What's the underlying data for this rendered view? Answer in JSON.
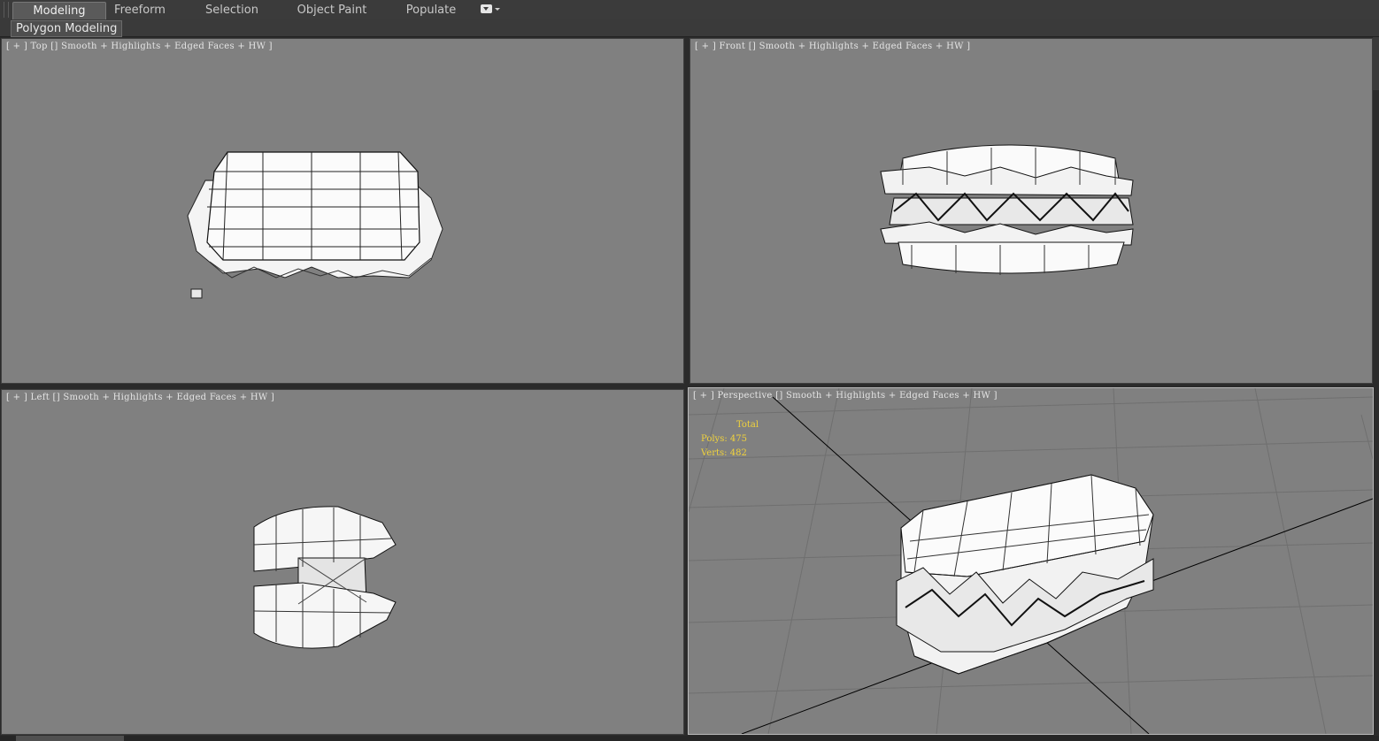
{
  "ribbon": {
    "tabs": [
      {
        "label": "Modeling",
        "active": true
      },
      {
        "label": "Freeform",
        "active": false
      },
      {
        "label": "Selection",
        "active": false
      },
      {
        "label": "Object Paint",
        "active": false
      },
      {
        "label": "Populate",
        "active": false
      }
    ],
    "panel_button": "Polygon Modeling"
  },
  "viewports": {
    "top": {
      "plus": "[ + ]",
      "view": "Top",
      "shading": "Smooth + Highlights + Edged Faces + HW ]"
    },
    "front": {
      "plus": "[ + ]",
      "view": "Front",
      "shading": "Smooth + Highlights + Edged Faces + HW ]"
    },
    "left": {
      "plus": "[ + ]",
      "view": "Left",
      "shading": "Smooth + Highlights + Edged Faces + HW ]"
    },
    "perspective": {
      "plus": "[ + ]",
      "view": "Perspective",
      "shading": "Smooth + Highlights + Edged Faces + HW ]",
      "stats": {
        "title": "Total",
        "polys_label": "Polys:",
        "polys": "475",
        "verts_label": "Verts:",
        "verts": "482"
      }
    }
  },
  "colors": {
    "viewport_bg": "#808080",
    "stats_text": "#f0d23c",
    "ui_dark": "#3b3b3b"
  }
}
